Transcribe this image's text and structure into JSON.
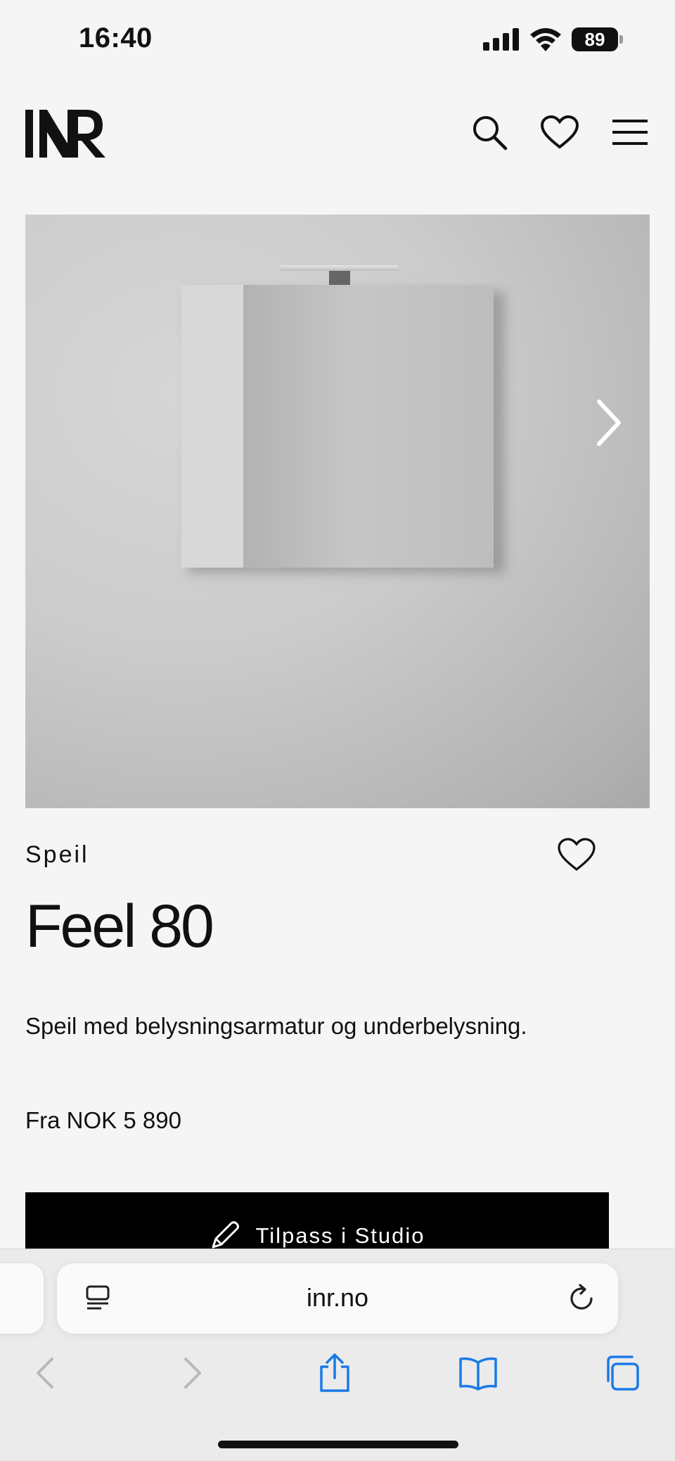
{
  "status_bar": {
    "time": "16:40",
    "battery": "89"
  },
  "header": {
    "logo_text": "INR",
    "icons": [
      "search-icon",
      "heart-icon",
      "menu-icon"
    ]
  },
  "hero": {
    "image": "bathroom-mirror-with-light-fixture",
    "next_icon": "chevron-right-icon"
  },
  "product": {
    "category": "Speil",
    "title": "Feel 80",
    "description": "Speil med belysningsarmatur og underbelysning.",
    "price": "Fra NOK 5 890",
    "cta_label": "Tilpass i Studio",
    "cta_icon": "pencil-icon"
  },
  "browser": {
    "url": "inr.no",
    "icons": [
      "reader-icon",
      "reload-icon",
      "back-icon",
      "forward-icon",
      "share-icon",
      "bookmarks-icon",
      "tabs-icon"
    ],
    "accent": "#1a7ae8"
  }
}
